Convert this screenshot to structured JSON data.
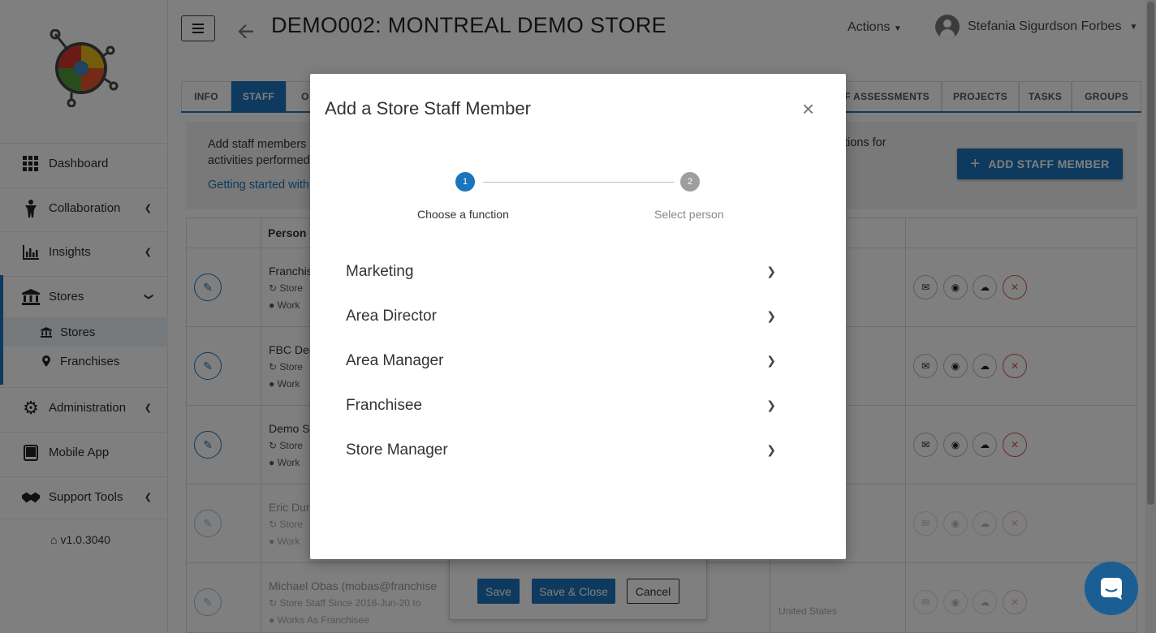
{
  "header": {
    "title": "DEMO002: MONTREAL DEMO STORE",
    "actions_label": "Actions",
    "user_name": "Stefania Sigurdson Forbes"
  },
  "sidebar": {
    "items": [
      {
        "label": "Dashboard",
        "icon": "grid-icon"
      },
      {
        "label": "Collaboration",
        "icon": "person-icon"
      },
      {
        "label": "Insights",
        "icon": "bar-chart-icon"
      },
      {
        "label": "Stores",
        "icon": "bank-icon"
      }
    ],
    "sub_items": [
      {
        "label": "Stores",
        "icon": "bank-icon"
      },
      {
        "label": "Franchises",
        "icon": "map-marker-icon"
      }
    ],
    "items_bottom": [
      {
        "label": "Administration",
        "icon": "gear-icon"
      },
      {
        "label": "Mobile App",
        "icon": "tablet-icon"
      },
      {
        "label": "Support Tools",
        "icon": "handshake-icon"
      }
    ],
    "version": "v1.0.3040"
  },
  "tabs": {
    "info": "INFO",
    "staff": "STAFF",
    "partial": "O",
    "self_assessments": "ELF ASSESSMENTS",
    "projects": "PROJECTS",
    "tasks": "TASKS",
    "groups": "GROUPS"
  },
  "content": {
    "info_line1": "Add staff members",
    "info_line2": "activities performed",
    "info_right": "tions for",
    "info_link": "Getting started with",
    "add_staff_label": "ADD STAFF MEMBER",
    "person_header": "Person"
  },
  "rows": [
    {
      "name": "Franchis",
      "sub1": "Store",
      "sub2": "Work"
    },
    {
      "name": "FBC Der",
      "sub1": "Store",
      "sub2": "Work"
    },
    {
      "name": "Demo S",
      "sub1": "Store",
      "sub2": "Work"
    },
    {
      "name": "Eric Dur",
      "sub1": "Store",
      "sub2": "Work"
    },
    {
      "name": "Michael Obas  (mobas@franchise",
      "sub1": "Store Staff Since   2016-Jun-20  to",
      "sub2": "Works As    Franchisee",
      "location": "United States"
    }
  ],
  "bottom_panel": {
    "save": "Save",
    "save_close": "Save & Close",
    "cancel": "Cancel"
  },
  "modal": {
    "title": "Add a Store Staff Member",
    "close": "×",
    "steps": [
      {
        "number": "1",
        "label": "Choose a function"
      },
      {
        "number": "2",
        "label": "Select person"
      }
    ],
    "functions": [
      "Marketing",
      "Area Director",
      "Area Manager",
      "Franchisee",
      "Store Manager"
    ]
  },
  "colors": {
    "primary": "#1b75bc",
    "step_active": "#1b75bc",
    "step_inactive": "#9e9e9e",
    "danger": "#d9534f"
  }
}
